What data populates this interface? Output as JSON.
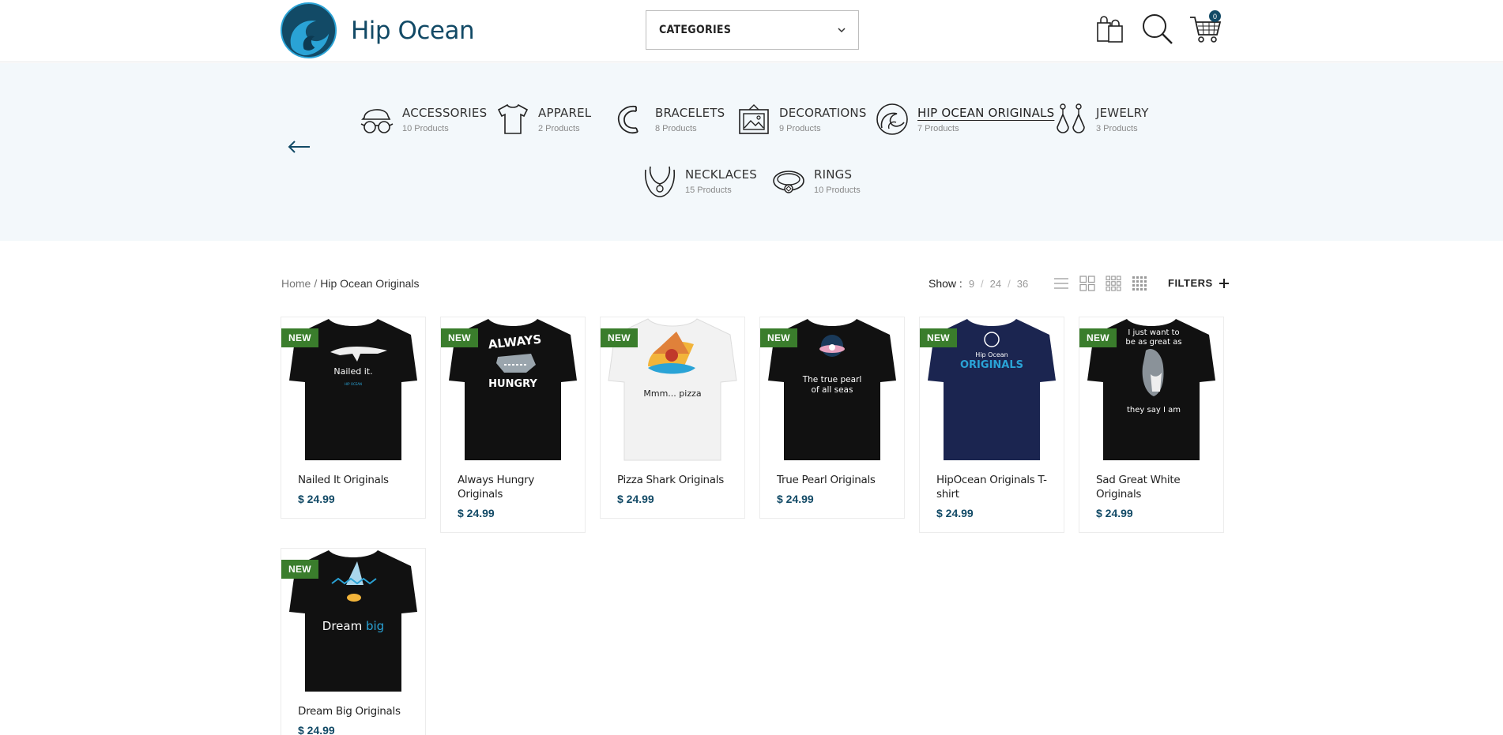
{
  "header": {
    "brand": "Hip Ocean",
    "categories_label": "CATEGORIES",
    "cart_count": "0"
  },
  "category_nav": [
    {
      "name": "ACCESSORIES",
      "count": "10 Products",
      "icon": "cap-sunglasses-icon"
    },
    {
      "name": "APPAREL",
      "count": "2 Products",
      "icon": "tshirt-icon"
    },
    {
      "name": "BRACELETS",
      "count": "8 Products",
      "icon": "bracelet-icon"
    },
    {
      "name": "DECORATIONS",
      "count": "9 Products",
      "icon": "picture-frame-icon"
    },
    {
      "name": "HIP OCEAN ORIGINALS",
      "count": "7 Products",
      "icon": "wave-logo-icon",
      "active": true
    },
    {
      "name": "JEWELRY",
      "count": "3 Products",
      "icon": "earrings-icon"
    },
    {
      "name": "NECKLACES",
      "count": "15 Products",
      "icon": "necklace-icon"
    },
    {
      "name": "RINGS",
      "count": "10 Products",
      "icon": "ring-icon"
    }
  ],
  "breadcrumb": {
    "home": "Home",
    "sep": "/",
    "current": "Hip Ocean Originals"
  },
  "toolbar": {
    "show_label": "Show :",
    "show_options": [
      "9",
      "24",
      "36"
    ],
    "separator": "/",
    "filters_label": "FILTERS",
    "filters_icon": "plus-icon",
    "view_icons": [
      "list-view-icon",
      "grid-2-icon",
      "grid-3-icon",
      "grid-4-icon"
    ]
  },
  "badge_label": "NEW",
  "products": [
    {
      "name": "Nailed It Originals",
      "price": "$ 24.99",
      "shirt": "#111111",
      "art": "Nailed it."
    },
    {
      "name": "Always Hungry Originals",
      "price": "$ 24.99",
      "shirt": "#111111",
      "art": "ALWAYS HUNGRY"
    },
    {
      "name": "Pizza Shark Originals",
      "price": "$ 24.99",
      "shirt": "#f2f2f2",
      "art": "Mmm... pizza"
    },
    {
      "name": "True Pearl Originals",
      "price": "$ 24.99",
      "shirt": "#111111",
      "art": "The true pearl of all seas"
    },
    {
      "name": "HipOcean Originals T-shirt",
      "price": "$ 24.99",
      "shirt": "#1b2550",
      "art": "Hip Ocean ORIGINALS"
    },
    {
      "name": "Sad Great White Originals",
      "price": "$ 24.99",
      "shirt": "#111111",
      "art": "I just want to be as great as they say I am"
    },
    {
      "name": "Dream Big Originals",
      "price": "$ 24.99",
      "shirt": "#111111",
      "art": "Dream big"
    }
  ],
  "colors": {
    "brand": "#124a66",
    "badge": "#3a7d2c",
    "band": "#f3f8fb"
  }
}
